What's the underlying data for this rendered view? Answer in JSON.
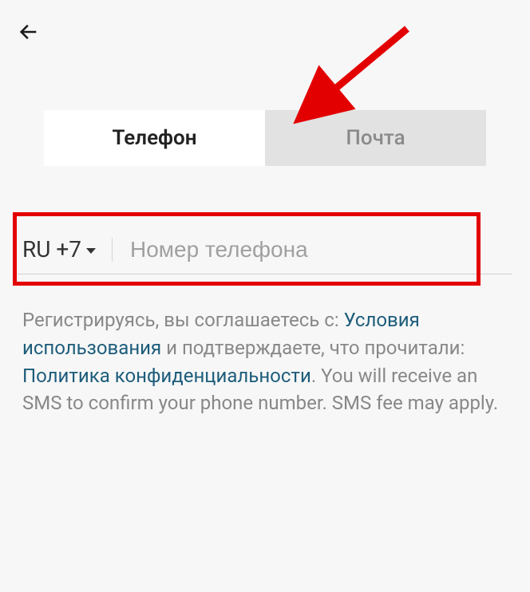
{
  "header": {
    "back_icon": "back-arrow"
  },
  "tabs": {
    "phone": "Телефон",
    "email": "Почта"
  },
  "phone_field": {
    "country_code": "RU +7",
    "placeholder": "Номер телефона"
  },
  "terms": {
    "pre1": "Регистрируясь, вы соглашаетесь с: ",
    "link1": "Условия использования",
    "mid1": " и подтверждаете, что прочитали: ",
    "link2": "Политика конфиденциальности",
    "post": ". You will receive an SMS to confirm your phone number. SMS fee may apply."
  }
}
